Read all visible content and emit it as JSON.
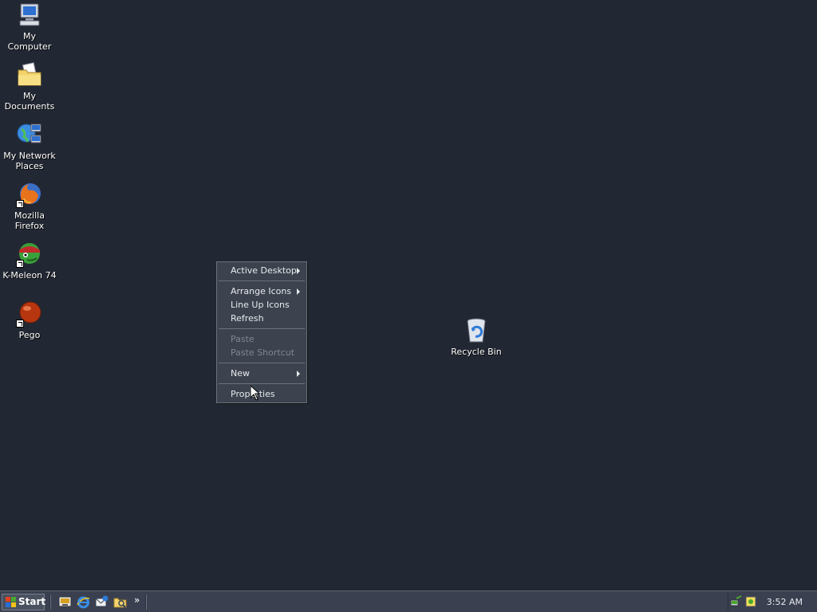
{
  "desktop": {
    "background_color": "#222833",
    "icons": [
      {
        "label": "My Computer",
        "icon": "computer-icon"
      },
      {
        "label": "My Documents",
        "icon": "folder-documents-icon"
      },
      {
        "label": "My Network Places",
        "icon": "network-places-icon"
      },
      {
        "label": "Mozilla Firefox",
        "icon": "firefox-icon"
      },
      {
        "label": "K-Meleon 74",
        "icon": "kmeleon-icon"
      },
      {
        "label": "Pego",
        "icon": "pego-icon"
      },
      {
        "label": "Recycle Bin",
        "icon": "recycle-bin-icon"
      }
    ]
  },
  "context_menu": {
    "items": [
      {
        "label": "Active Desktop",
        "submenu": true,
        "disabled": false
      },
      {
        "label": "Arrange Icons",
        "submenu": true,
        "disabled": false
      },
      {
        "label": "Line Up Icons",
        "submenu": false,
        "disabled": false
      },
      {
        "label": "Refresh",
        "submenu": false,
        "disabled": false
      },
      {
        "label": "Paste",
        "submenu": false,
        "disabled": true
      },
      {
        "label": "Paste Shortcut",
        "submenu": false,
        "disabled": true
      },
      {
        "label": "New",
        "submenu": true,
        "disabled": false
      },
      {
        "label": "Properties",
        "submenu": false,
        "disabled": false
      }
    ]
  },
  "taskbar": {
    "start_label": "Start",
    "quick_launch": [
      "show-desktop-icon",
      "internet-explorer-icon",
      "outlook-express-icon",
      "windows-explorer-icon"
    ],
    "chevron": "»",
    "tray_icons": [
      "network-tray-icon",
      "tray-app-icon"
    ],
    "clock": "3:52 AM"
  },
  "colors": {
    "menu_background": "#3c434e",
    "taskbar_background": "#3a4050",
    "disabled_text": "#7f8690"
  }
}
